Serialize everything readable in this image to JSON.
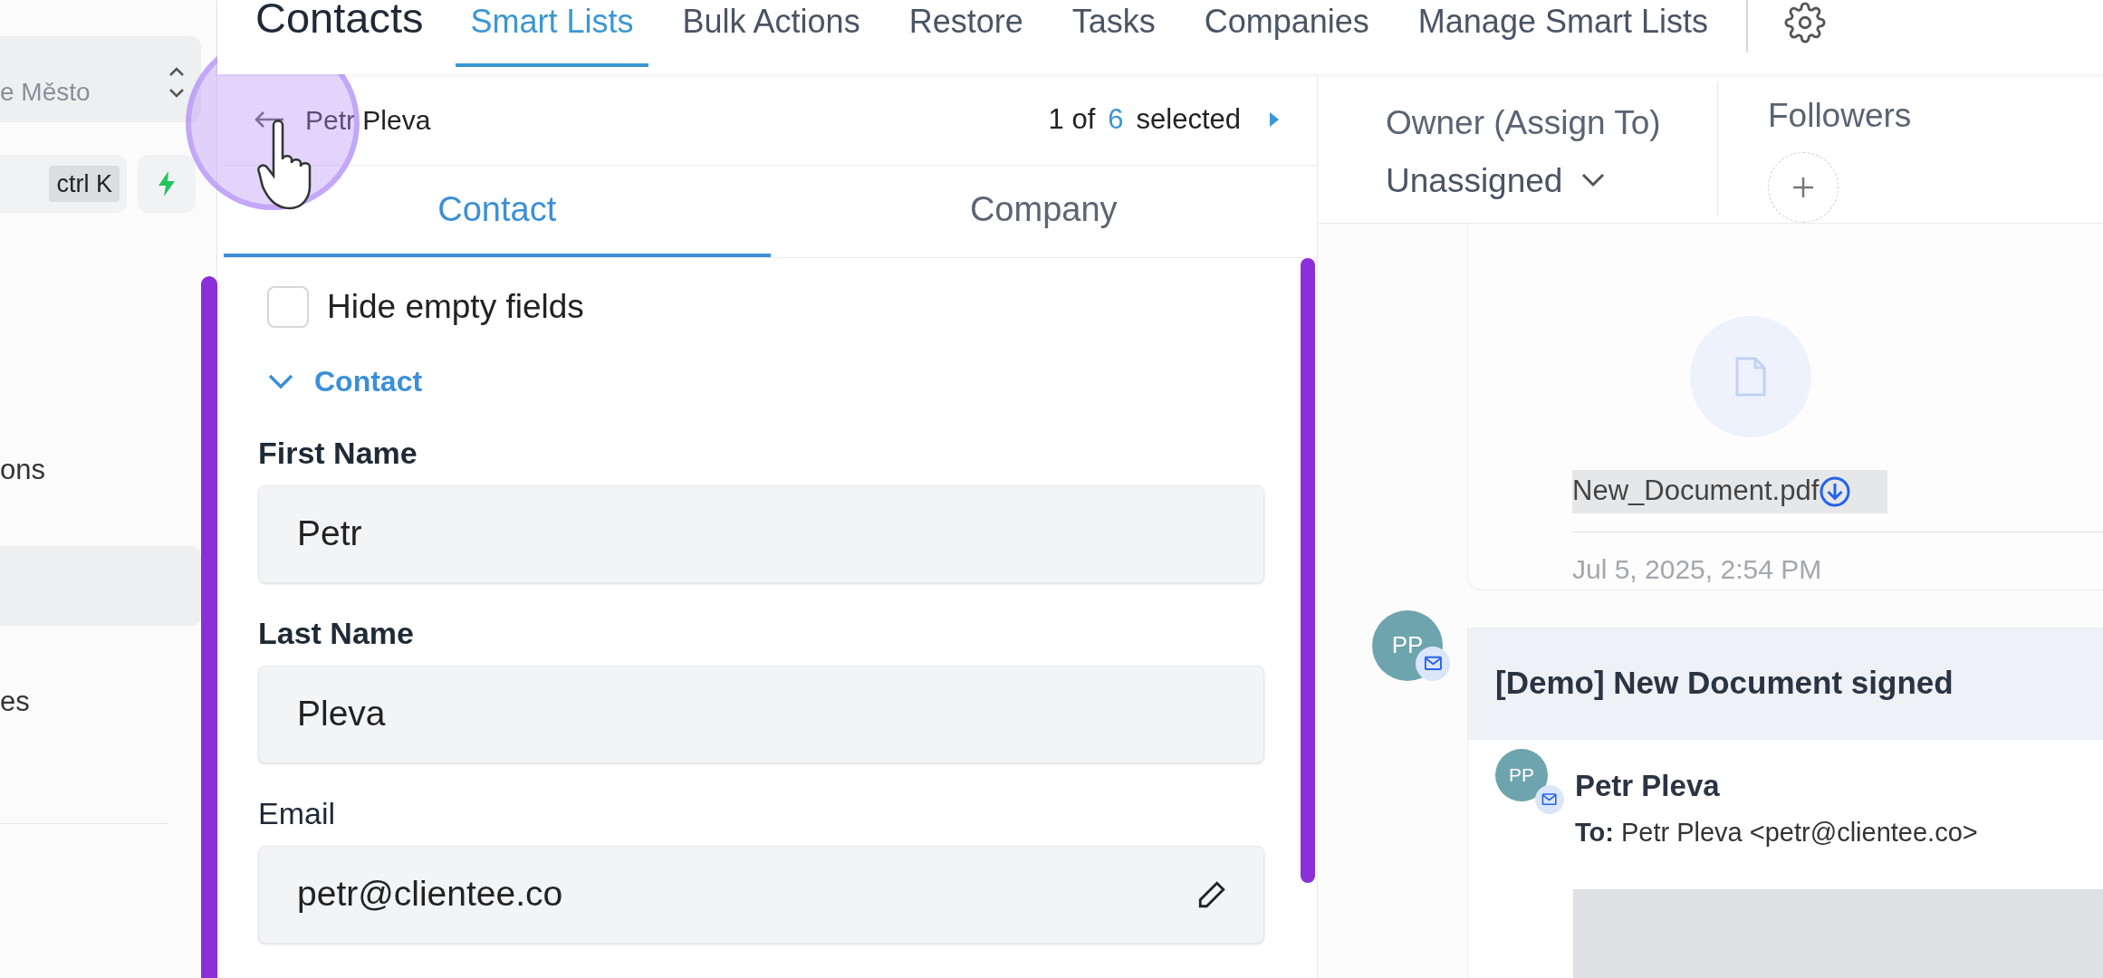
{
  "sidebar": {
    "switcher_text": "e Město",
    "search_shortcut": "ctrl K",
    "nav_items": [
      {
        "label": "ons",
        "selected": false
      },
      {
        "selected": true
      },
      {
        "label": "es",
        "selected": false
      }
    ]
  },
  "header": {
    "title": "Contacts",
    "tabs": [
      {
        "label": "Smart Lists",
        "selected": true
      },
      {
        "label": "Bulk Actions",
        "selected": false
      },
      {
        "label": "Restore",
        "selected": false
      },
      {
        "label": "Tasks",
        "selected": false
      },
      {
        "label": "Companies",
        "selected": false
      },
      {
        "label": "Manage Smart Lists",
        "selected": false
      }
    ]
  },
  "record": {
    "name": "Petr Pleva",
    "pager": {
      "prefix": "1 of",
      "count": "6",
      "suffix": "selected"
    },
    "tabs": [
      {
        "label": "Contact",
        "selected": true
      },
      {
        "label": "Company",
        "selected": false
      }
    ],
    "hide_empty_fields": {
      "label": "Hide empty fields",
      "checked": false
    },
    "section": {
      "title": "Contact",
      "expanded": true
    },
    "fields": [
      {
        "label": "First Name",
        "value": "Petr",
        "editable": false
      },
      {
        "label": "Last Name",
        "value": "Pleva",
        "editable": false
      },
      {
        "label": "Email",
        "value": "petr@clientee.co",
        "editable": true
      }
    ]
  },
  "owner": {
    "label": "Owner (Assign To)",
    "value": "Unassigned"
  },
  "followers": {
    "label": "Followers"
  },
  "activity": {
    "attachment": {
      "file_name": "New_Document.pdf",
      "date": "Jul 5, 2025, 2:54 PM"
    },
    "email": {
      "avatar_initials": "PP",
      "subject": "[Demo] New Document signed",
      "sender": {
        "initials": "PP",
        "name": "Petr Pleva",
        "to_label": "To:",
        "to_value": "Petr Pleva <petr@clientee.co>"
      }
    }
  }
}
